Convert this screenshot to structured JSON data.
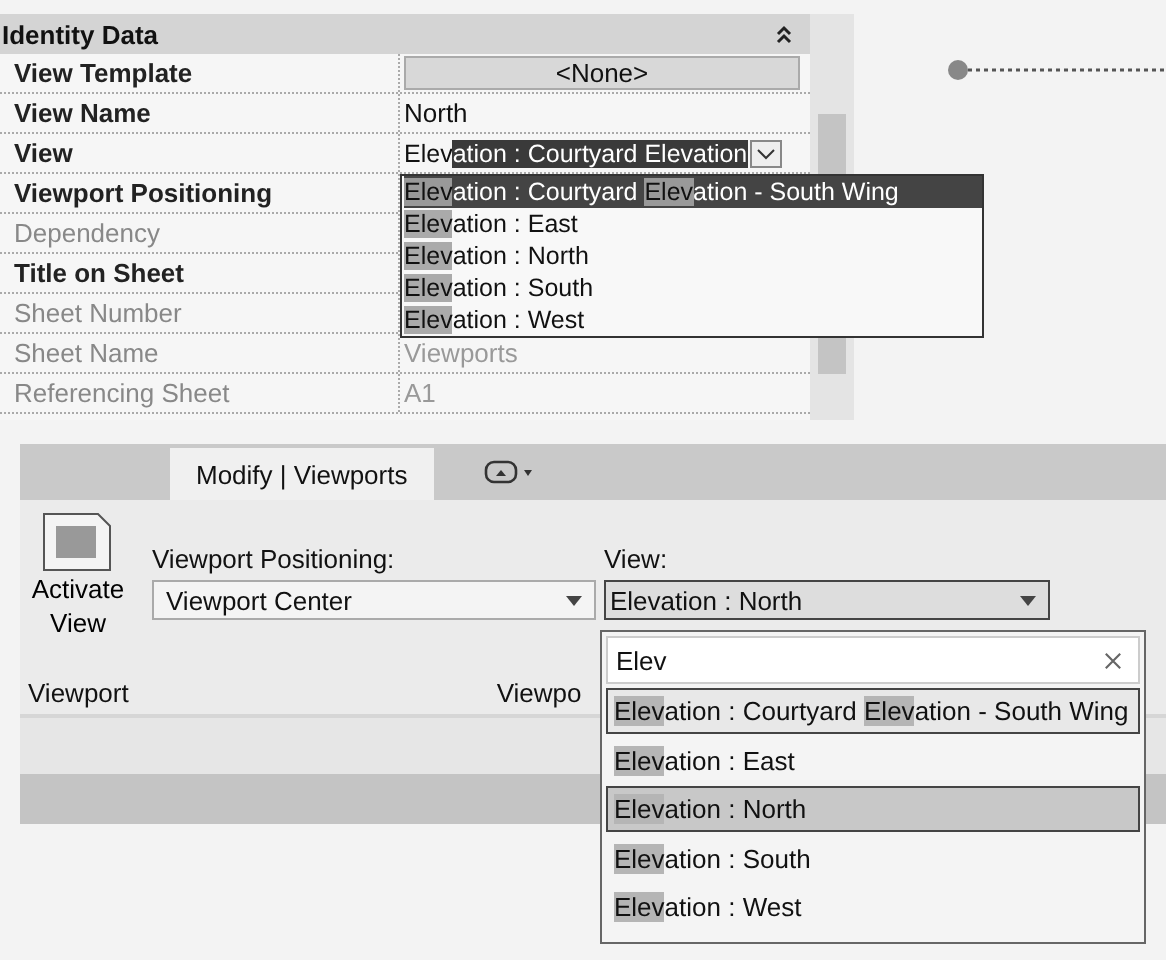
{
  "properties": {
    "group": "Identity Data",
    "expanded": true,
    "rows": [
      {
        "label": "View Template",
        "disabled": false,
        "kind": "button",
        "value": "<None>"
      },
      {
        "label": "View Name",
        "disabled": false,
        "kind": "text",
        "value": "North"
      },
      {
        "label": "View",
        "disabled": false,
        "kind": "dropdown",
        "segments": [
          {
            "text": "Elev",
            "highlighted": false
          },
          {
            "text": "ation : Courtyard Elevation",
            "highlighted": true
          }
        ]
      },
      {
        "label": "Viewport Positioning",
        "disabled": false,
        "kind": "hidden"
      },
      {
        "label": "Dependency",
        "disabled": true,
        "kind": "hidden"
      },
      {
        "label": "Title on Sheet",
        "disabled": false,
        "kind": "hidden"
      },
      {
        "label": "Sheet Number",
        "disabled": true,
        "kind": "hidden"
      },
      {
        "label": "Sheet Name",
        "disabled": true,
        "kind": "text",
        "value": "Viewports"
      },
      {
        "label": "Referencing Sheet",
        "disabled": true,
        "kind": "text",
        "value": "A1"
      }
    ],
    "list": [
      {
        "selected": true,
        "segments": [
          {
            "text": "Elev",
            "highlighted": true
          },
          {
            "text": "ation : Courtyard ",
            "highlighted": false
          },
          {
            "text": "Elev",
            "highlighted": true
          },
          {
            "text": "ation - South Wing",
            "highlighted": false
          }
        ]
      },
      {
        "selected": false,
        "segments": [
          {
            "text": "Elev",
            "highlighted": true
          },
          {
            "text": "ation : East",
            "highlighted": false
          }
        ]
      },
      {
        "selected": false,
        "segments": [
          {
            "text": "Elev",
            "highlighted": true
          },
          {
            "text": "ation : North",
            "highlighted": false
          }
        ]
      },
      {
        "selected": false,
        "segments": [
          {
            "text": "Elev",
            "highlighted": true
          },
          {
            "text": "ation : South",
            "highlighted": false
          }
        ]
      },
      {
        "selected": false,
        "segments": [
          {
            "text": "Elev",
            "highlighted": true
          },
          {
            "text": "ation : West",
            "highlighted": false
          }
        ]
      }
    ]
  },
  "ribbon": {
    "tabs": [
      {
        "label": "Modify | Viewports",
        "selected": true
      }
    ],
    "activate_button": [
      "Activate",
      "View"
    ],
    "positioning": {
      "label": "Viewport Positioning:",
      "value": "Viewport Center"
    },
    "view": {
      "label": "View:",
      "value": "Elevation : North"
    },
    "panel_labels": [
      "Viewport",
      "Viewpo"
    ],
    "search": {
      "value": "Elev"
    },
    "list": [
      {
        "selected": false,
        "hovered": true,
        "segments": [
          {
            "text": "Elev",
            "highlighted": true
          },
          {
            "text": "ation : Courtyard ",
            "highlighted": false
          },
          {
            "text": "Elev",
            "highlighted": true
          },
          {
            "text": "ation - South Wing",
            "highlighted": false
          }
        ]
      },
      {
        "selected": false,
        "hovered": false,
        "segments": [
          {
            "text": "Elev",
            "highlighted": true
          },
          {
            "text": "ation : East",
            "highlighted": false
          }
        ]
      },
      {
        "selected": true,
        "hovered": false,
        "segments": [
          {
            "text": "Elev",
            "highlighted": true
          },
          {
            "text": "ation : North",
            "highlighted": false
          }
        ]
      },
      {
        "selected": false,
        "hovered": false,
        "segments": [
          {
            "text": "Elev",
            "highlighted": true
          },
          {
            "text": "ation : South",
            "highlighted": false
          }
        ]
      },
      {
        "selected": false,
        "hovered": false,
        "segments": [
          {
            "text": "Elev",
            "highlighted": true
          },
          {
            "text": "ation : West",
            "highlighted": false
          }
        ]
      }
    ]
  }
}
